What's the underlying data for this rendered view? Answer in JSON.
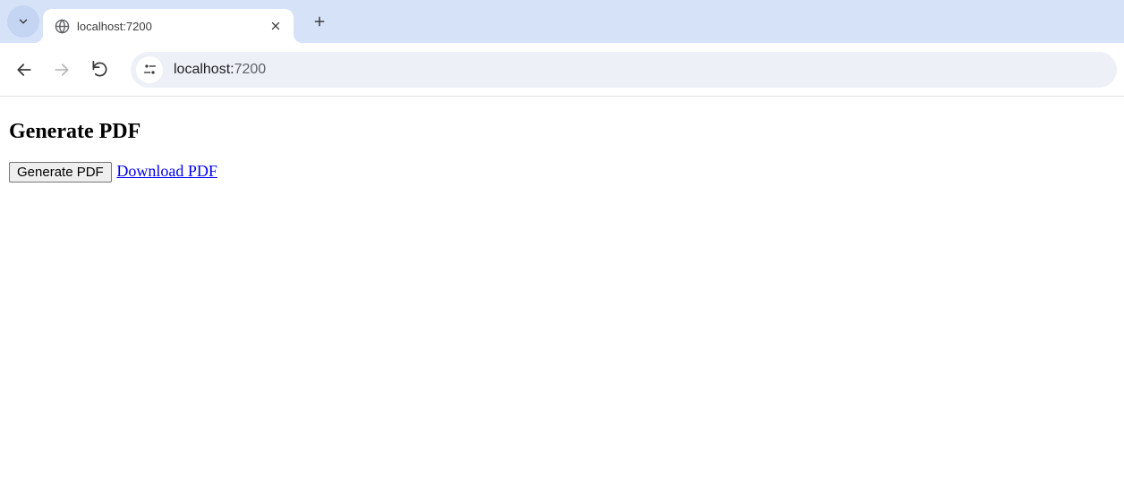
{
  "tab": {
    "title": "localhost:7200"
  },
  "address": {
    "host": "localhost:",
    "port": "7200"
  },
  "page": {
    "heading": "Generate PDF",
    "button_label": "Generate PDF",
    "link_label": "Download PDF"
  }
}
